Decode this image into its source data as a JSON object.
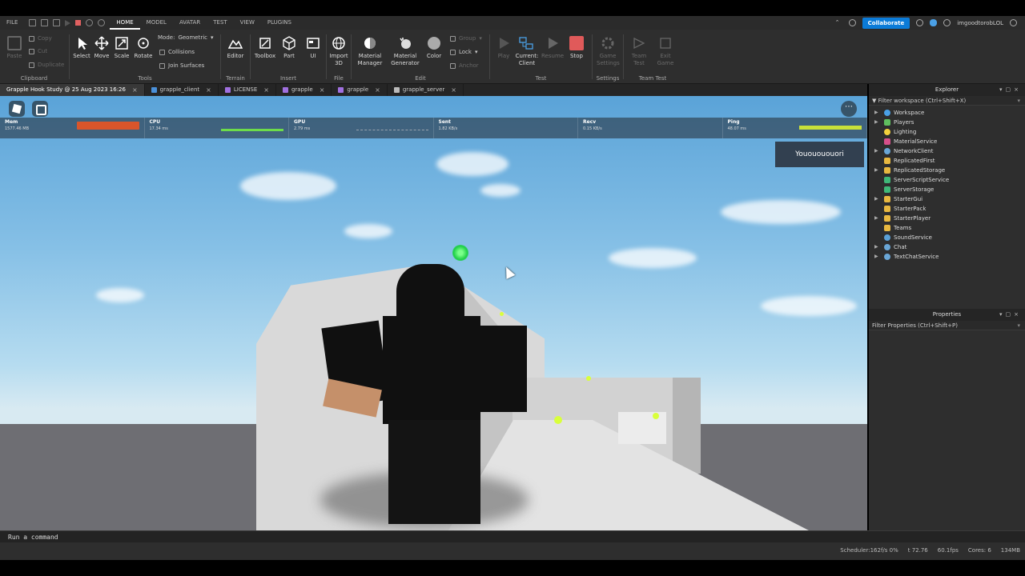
{
  "menubar": {
    "items": [
      "FILE",
      "HOME",
      "MODEL",
      "AVATAR",
      "TEST",
      "VIEW",
      "PLUGINS"
    ],
    "active": "HOME",
    "collaborate": "Collaborate",
    "username": "imgoodtorobLOL"
  },
  "ribbon": {
    "clipboard": {
      "paste": "Paste",
      "copy": "Copy",
      "cut": "Cut",
      "duplicate": "Duplicate",
      "label": "Clipboard"
    },
    "tools": {
      "select": "Select",
      "move": "Move",
      "scale": "Scale",
      "rotate": "Rotate",
      "mode_label": "Mode:",
      "mode_value": "Geometric",
      "collisions": "Collisions",
      "join_surfaces": "Join Surfaces",
      "label": "Tools"
    },
    "terrain": {
      "editor": "Editor",
      "label": "Terrain"
    },
    "insert": {
      "toolbox": "Toolbox",
      "part": "Part",
      "ui": "UI",
      "label": "Insert"
    },
    "file": {
      "import3d": "Import 3D",
      "label": "File"
    },
    "edit": {
      "material_manager": "Material Manager",
      "material_generator": "Material Generator",
      "color": "Color",
      "group": "Group",
      "lock": "Lock",
      "anchor": "Anchor",
      "label": "Edit"
    },
    "test": {
      "play": "Play",
      "current_client": "Current: Client",
      "resume": "Resume",
      "stop": "Stop",
      "label": "Test"
    },
    "settings": {
      "game_settings": "Game Settings",
      "label": "Settings"
    },
    "team_test": {
      "team_test": "Team Test",
      "exit_game": "Exit Game",
      "label": "Team Test"
    }
  },
  "tabs": [
    {
      "label": "Grapple Hook Study @ 25 Aug 2023 16:26",
      "color": "#888888"
    },
    {
      "label": "grapple_client",
      "color": "#4a90d9"
    },
    {
      "label": "LICENSE",
      "color": "#a070e0"
    },
    {
      "label": "grapple",
      "color": "#a070e0"
    },
    {
      "label": "grapple",
      "color": "#a070e0"
    },
    {
      "label": "grapple_server",
      "color": "#bbbbbb"
    }
  ],
  "stats": [
    {
      "name": "Mem",
      "value": "1577.46 MB",
      "bar_color": "#d9552b"
    },
    {
      "name": "CPU",
      "value": "17.34 ms",
      "bar_color": "#6ddc4a"
    },
    {
      "name": "GPU",
      "value": "2.79 ms",
      "bar_color": "#9aa3ad"
    },
    {
      "name": "Sent",
      "value": "1.82 KB/s",
      "bar_color": ""
    },
    {
      "name": "Recv",
      "value": "0.15 KB/s",
      "bar_color": ""
    },
    {
      "name": "Ping",
      "value": "48.07 ms",
      "bar_color": "#c9e03a"
    }
  ],
  "viewport": {
    "player_name": "Yououououori"
  },
  "explorer": {
    "title": "Explorer",
    "filter": "Filter workspace (Ctrl+Shift+X)",
    "items": [
      {
        "label": "Workspace",
        "expandable": true,
        "icon_color": "#4aa0e6"
      },
      {
        "label": "Players",
        "expandable": true,
        "icon_color": "#5fbf5f"
      },
      {
        "label": "Lighting",
        "expandable": false,
        "icon_color": "#f2d03c"
      },
      {
        "label": "MaterialService",
        "expandable": false,
        "icon_color": "#d64f8a"
      },
      {
        "label": "NetworkClient",
        "expandable": true,
        "icon_color": "#6aa6d6"
      },
      {
        "label": "ReplicatedFirst",
        "expandable": false,
        "icon_color": "#e8b840"
      },
      {
        "label": "ReplicatedStorage",
        "expandable": true,
        "icon_color": "#e8b840"
      },
      {
        "label": "ServerScriptService",
        "expandable": false,
        "icon_color": "#3fb878"
      },
      {
        "label": "ServerStorage",
        "expandable": false,
        "icon_color": "#3fb878"
      },
      {
        "label": "StarterGui",
        "expandable": true,
        "icon_color": "#e8b840"
      },
      {
        "label": "StarterPack",
        "expandable": false,
        "icon_color": "#e8b840"
      },
      {
        "label": "StarterPlayer",
        "expandable": true,
        "icon_color": "#e8b840"
      },
      {
        "label": "Teams",
        "expandable": false,
        "icon_color": "#e8b840"
      },
      {
        "label": "SoundService",
        "expandable": false,
        "icon_color": "#5aa0d6"
      },
      {
        "label": "Chat",
        "expandable": true,
        "icon_color": "#6aa6d6"
      },
      {
        "label": "TextChatService",
        "expandable": true,
        "icon_color": "#6aa6d6"
      }
    ]
  },
  "properties": {
    "title": "Properties",
    "filter": "Filter Properties (Ctrl+Shift+P)"
  },
  "command_bar": {
    "placeholder": "Run a command"
  },
  "status": {
    "scheduler": "Scheduler:162f/s 0%",
    "t": "t 72.76",
    "fps": "60.1fps",
    "cores": "Cores: 6",
    "mem": "134MB"
  }
}
